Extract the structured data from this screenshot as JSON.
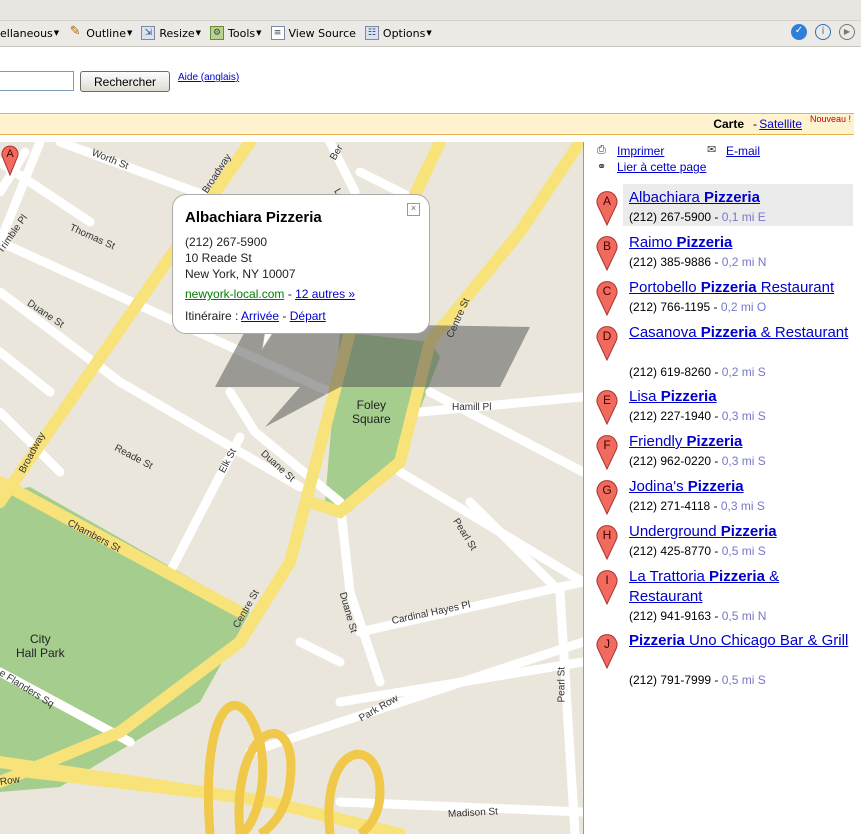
{
  "toolbar": {
    "items": [
      {
        "label": "ellaneous",
        "icon": "misc-icon"
      },
      {
        "label": "Outline",
        "icon": "outline-icon"
      },
      {
        "label": "Resize",
        "icon": "resize-icon"
      },
      {
        "label": "Tools",
        "icon": "tools-icon"
      },
      {
        "label": "View Source",
        "icon": "view-source-icon"
      },
      {
        "label": "Options",
        "icon": "options-icon"
      }
    ]
  },
  "search": {
    "input_value": "",
    "button_label": "Rechercher",
    "help_link": "Aide (anglais)"
  },
  "mapbar": {
    "carte": "Carte",
    "separator": "-",
    "satellite": "Satellite",
    "new_badge": "Nouveau !"
  },
  "map": {
    "streets": [
      "Worth St",
      "Broadway",
      "Thomas St",
      "Duane St",
      "Trimble Pl",
      "Reade St",
      "Elk St",
      "Duane St",
      "Chambers St",
      "Centre St",
      "Hamill Pl",
      "Pearl St",
      "Duane St",
      "Cardinal Hayes Pl",
      "Park Row",
      "Madison St",
      "Row",
      "Centre St",
      "Broadway",
      "Ber",
      "Le",
      "e Flanders Sq"
    ],
    "areas": [
      "Foley\nSquare",
      "City\nHall Park"
    ],
    "marker_letter": "A"
  },
  "infowindow": {
    "name": "Albachiara Pizzeria",
    "phone": "(212) 267-5900",
    "address1": "10 Reade St",
    "address2": "New York, NY 10007",
    "site": "newyork-local.com",
    "site_sep": "-",
    "more": "12 autres »",
    "itinerary_label": "Itinéraire :",
    "arrival": "Arrivée",
    "dash": "-",
    "departure": "Départ"
  },
  "sidebar": {
    "print": "Imprimer",
    "email": "E-mail",
    "link": "Lier à cette page",
    "results": [
      {
        "letter": "A",
        "pre": "Albachiara ",
        "bold": "Pizzeria",
        "post": "",
        "pre2": "",
        "phone": "(212) 267-5900",
        "dist": "0,1 mi E"
      },
      {
        "letter": "B",
        "pre": "Raimo ",
        "bold": "Pizzeria",
        "post": "",
        "phone": "(212) 385-9886",
        "dist": "0,2 mi N"
      },
      {
        "letter": "C",
        "pre": "Portobello ",
        "bold": "Pizzeria",
        "post": " Restaurant",
        "phone": "(212) 766-1195",
        "dist": "0,2 mi O"
      },
      {
        "letter": "D",
        "pre": "Casanova ",
        "bold": "Pizzeria",
        "post": " & Restaurant",
        "phone": "(212) 619-8260",
        "dist": "0,2 mi S"
      },
      {
        "letter": "E",
        "pre": "Lisa ",
        "bold": "Pizzeria",
        "post": "",
        "phone": "(212) 227-1940",
        "dist": "0,3 mi S"
      },
      {
        "letter": "F",
        "pre": "Friendly ",
        "bold": "Pizzeria",
        "post": "",
        "phone": "(212) 962-0220",
        "dist": "0,3 mi S"
      },
      {
        "letter": "G",
        "pre": "Jodina's ",
        "bold": "Pizzeria",
        "post": "",
        "phone": "(212) 271-4118",
        "dist": "0,3 mi S"
      },
      {
        "letter": "H",
        "pre": "Underground ",
        "bold": "Pizzeria",
        "post": "",
        "phone": "(212) 425-8770",
        "dist": "0,5 mi S"
      },
      {
        "letter": "I",
        "pre": "La Trattoria ",
        "bold": "Pizzeria",
        "post": " & Restaurant",
        "phone": "(212) 941-9163",
        "dist": "0,5 mi N"
      },
      {
        "letter": "J",
        "pre": "",
        "bold": "Pizzeria",
        "post": " Uno Chicago Bar & Grill",
        "phone": "(212) 791-7999",
        "dist": "0,5 mi S"
      }
    ]
  },
  "colors": {
    "road_major": "#f8e27a",
    "road_minor": "#ffffff",
    "park": "#a5cd8e",
    "map_bg": "#ebe6dc",
    "marker": "#f06b5e",
    "link": "#0000cc"
  }
}
